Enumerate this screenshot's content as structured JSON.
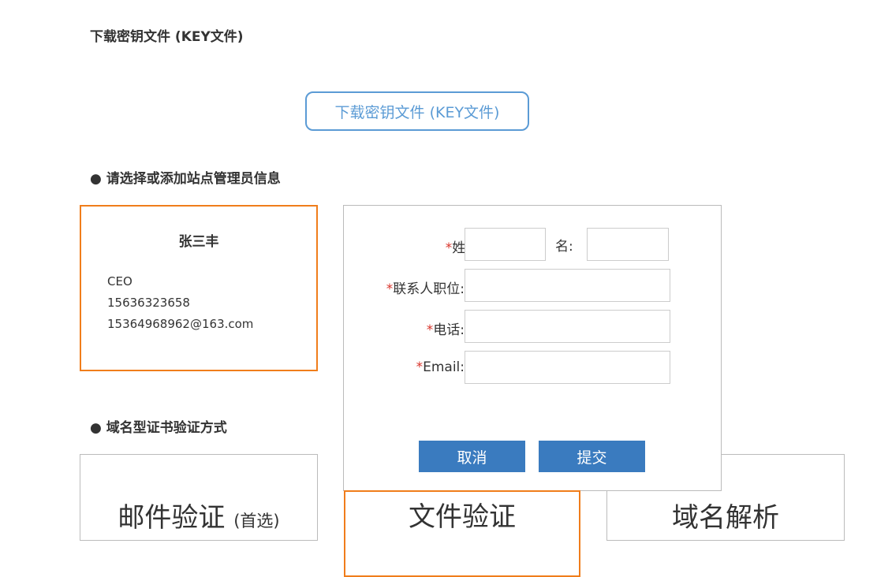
{
  "sections": {
    "key_file_title": "下载密钥文件 (KEY文件)",
    "admin_title": "● 请选择或添加站点管理员信息",
    "method_title": "● 域名型证书验证方式"
  },
  "key_download": {
    "label": "下载密钥文件 (KEY文件)"
  },
  "admin_card": {
    "name": "张三丰",
    "role": "CEO",
    "phone": "15636323658",
    "email": "15364968962@163.com"
  },
  "form": {
    "required_mark": "*",
    "last_name_label": "姓:",
    "first_name_label": "名:",
    "title_label": "联系人职位:",
    "phone_label": "电话:",
    "email_label": "Email:",
    "cancel_label": "取消",
    "submit_label": "提交"
  },
  "methods": {
    "email": {
      "label": "邮件验证",
      "note": "(首选)"
    },
    "file": {
      "label": "文件验证"
    },
    "dns": {
      "label": "域名解析"
    }
  },
  "colors": {
    "accent_orange": "#f07d1b",
    "button_blue": "#3a7bbf",
    "link_blue": "#5b9bd5",
    "required_red": "#d9342b"
  }
}
